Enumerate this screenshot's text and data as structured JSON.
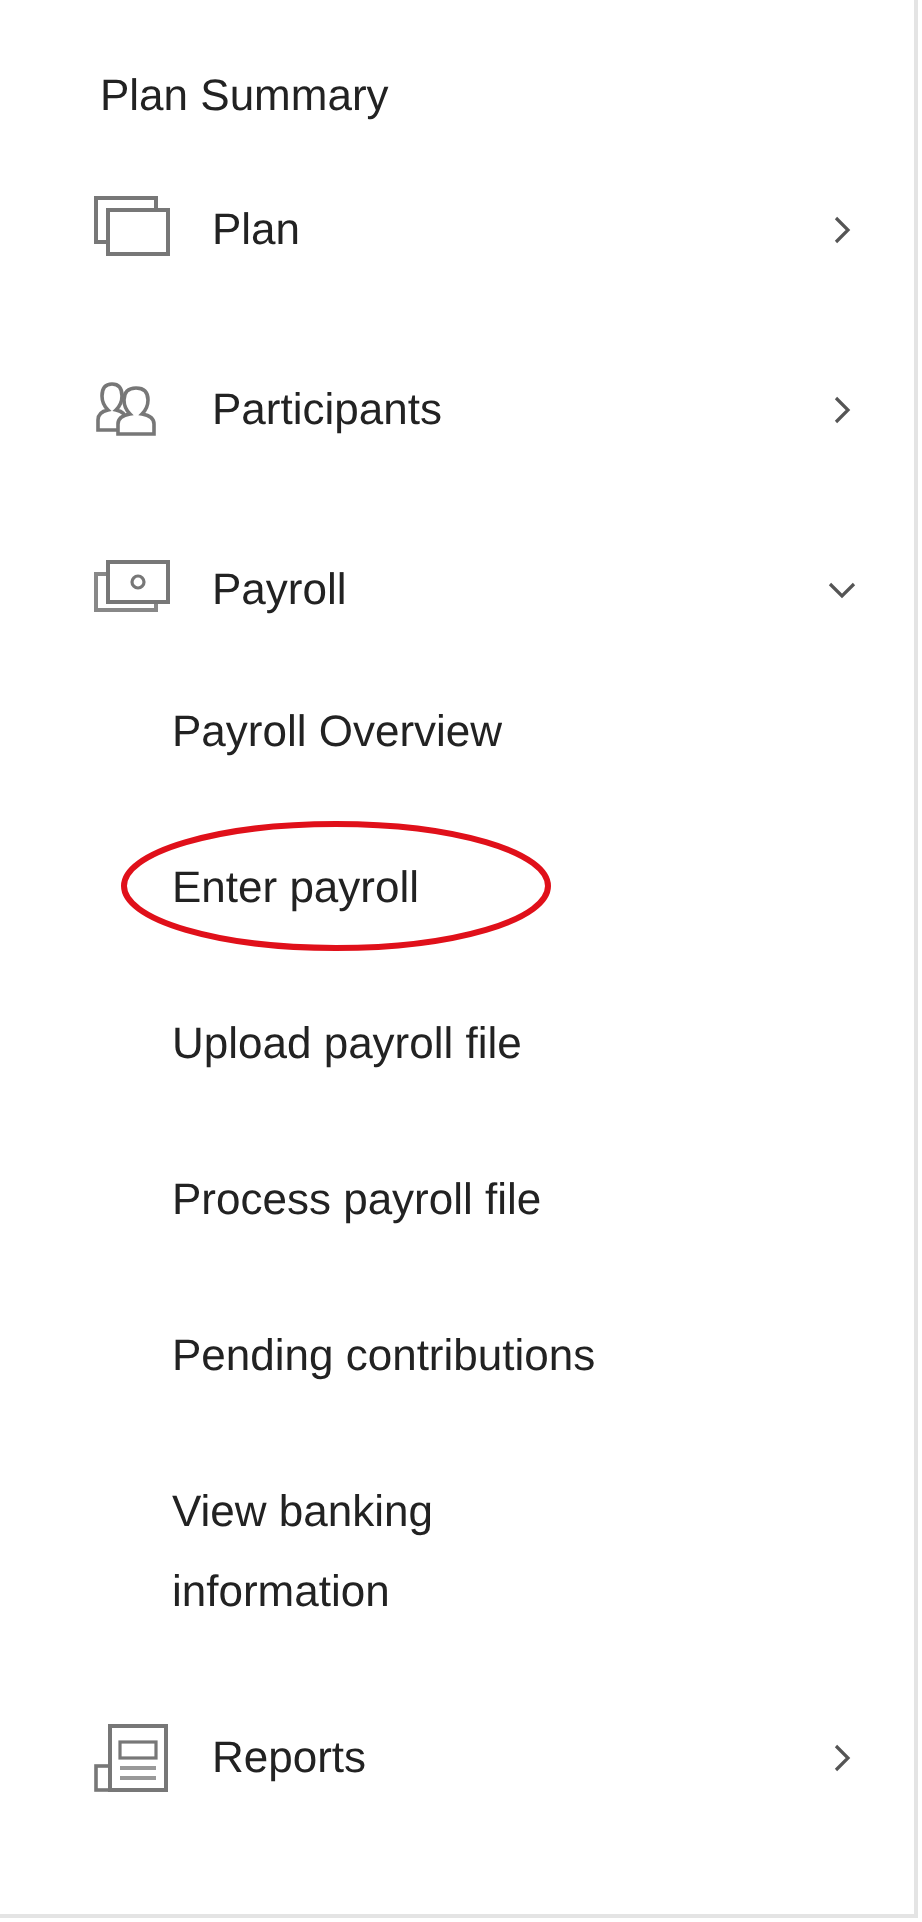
{
  "heading": "Plan Summary",
  "items": [
    {
      "label": "Plan",
      "kind": "windows",
      "expanded": false
    },
    {
      "label": "Participants",
      "kind": "people",
      "expanded": false
    },
    {
      "label": "Payroll",
      "kind": "money",
      "expanded": true,
      "children": [
        {
          "label": "Payroll Overview",
          "circled": false
        },
        {
          "label": "Enter payroll",
          "circled": true
        },
        {
          "label": "Upload payroll file",
          "circled": false
        },
        {
          "label": "Process payroll file",
          "circled": false
        },
        {
          "label": "Pending contributions",
          "circled": false
        },
        {
          "label": "View banking information",
          "circled": false
        }
      ]
    },
    {
      "label": "Reports",
      "kind": "report",
      "expanded": false
    }
  ]
}
